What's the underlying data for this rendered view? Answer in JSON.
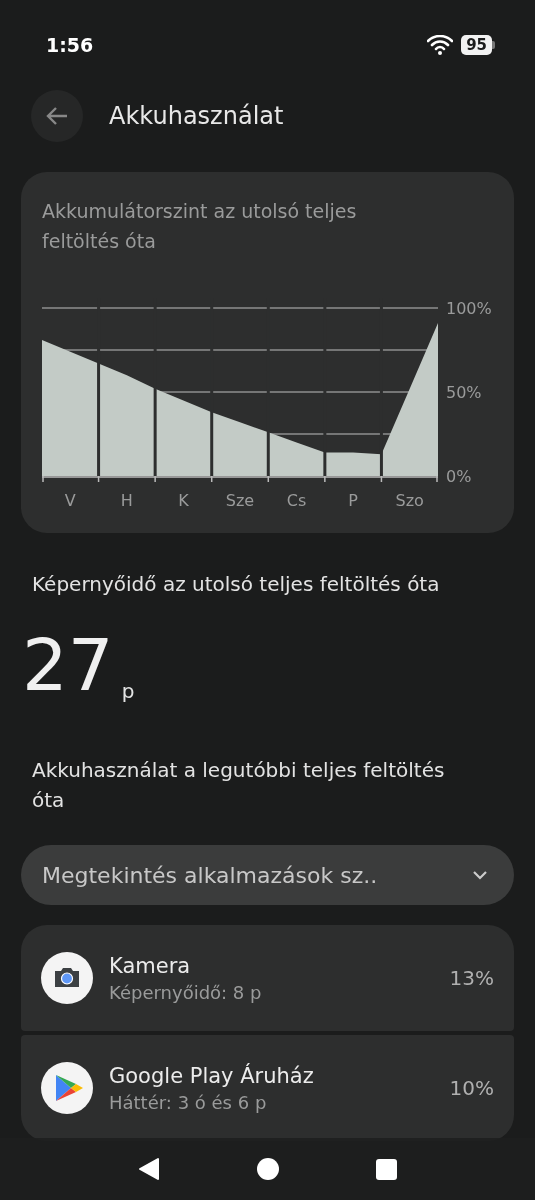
{
  "status_bar": {
    "time": "1:56",
    "battery": "95"
  },
  "header": {
    "title": "Akkuhasználat"
  },
  "battery_chart": {
    "title": "Akkumulátorszint az utolsó teljes feltöltés óta",
    "chart_data": {
      "type": "area",
      "grid": true,
      "categories": [
        null,
        "V",
        null,
        "H",
        null,
        "K",
        null,
        "Sze",
        null,
        "Cs",
        null,
        "P",
        null,
        "Szo",
        null
      ],
      "series": [
        {
          "color": "#c3cbc6",
          "values": [
            81,
            74,
            67,
            60,
            52,
            45,
            38,
            32,
            26,
            20,
            14,
            14,
            13,
            52,
            91
          ]
        }
      ],
      "ylim": [
        0,
        100
      ],
      "yticks": [
        {
          "value": 0,
          "label": "0%"
        },
        {
          "value": 50,
          "label": "50%"
        },
        {
          "value": 100,
          "label": "100%"
        }
      ]
    }
  },
  "screen_time": {
    "label": "Képernyőidő az utolsó teljes feltöltés óta",
    "value": "27",
    "unit": "p"
  },
  "usage": {
    "label": "Akkuhasználat a legutóbbi teljes feltöltés óta",
    "dropdown": "Megtekintés alkalmazások sz..",
    "apps": [
      {
        "name": "Kamera",
        "detail": "Képernyőidő: 8 p",
        "percent": "13%",
        "kind": "camera"
      },
      {
        "name": "Google Play Áruház",
        "detail": "Háttér: 3 ó és 6 p",
        "percent": "10%",
        "kind": "play"
      }
    ]
  }
}
